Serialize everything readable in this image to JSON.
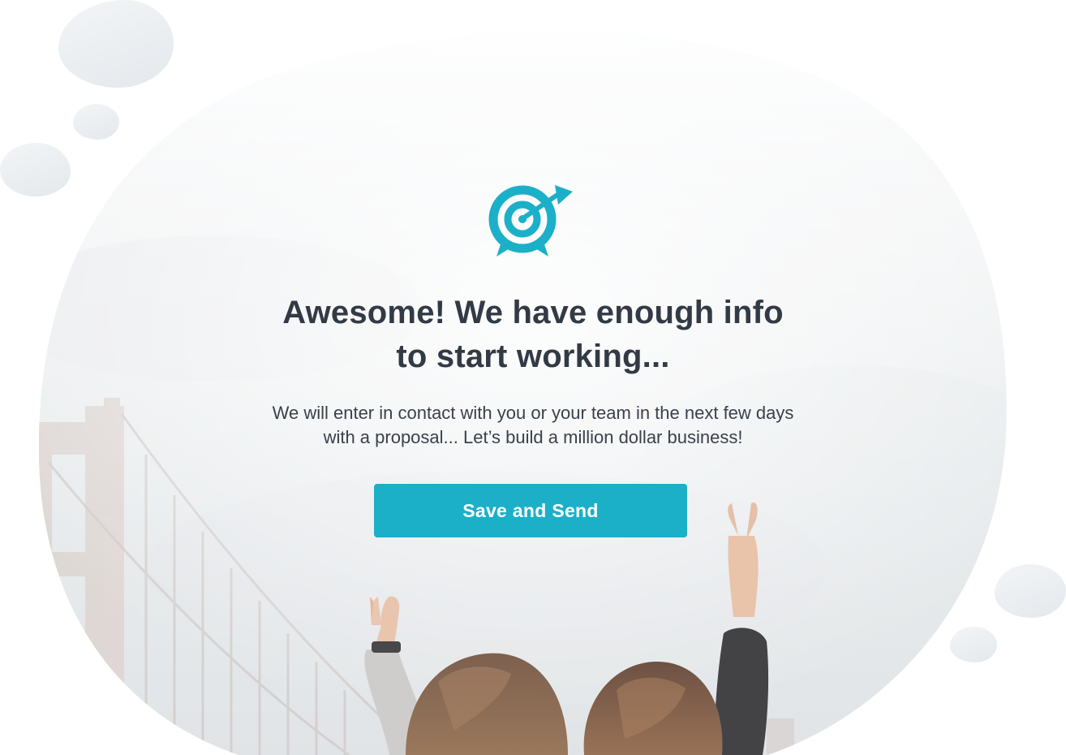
{
  "colors": {
    "accent": "#1bb0c8",
    "heading": "#323a45",
    "body": "#3a414c",
    "bubble": "#e8ecef"
  },
  "icon": "target-arrow-icon",
  "headline": {
    "line1": "Awesome! We have enough info",
    "line2": "to start working..."
  },
  "message": {
    "line1": "We will enter in contact with you or your team in the next few days",
    "line2": "with a proposal... Let’s build a million dollar business!"
  },
  "actions": {
    "primary_label": "Save and Send"
  }
}
